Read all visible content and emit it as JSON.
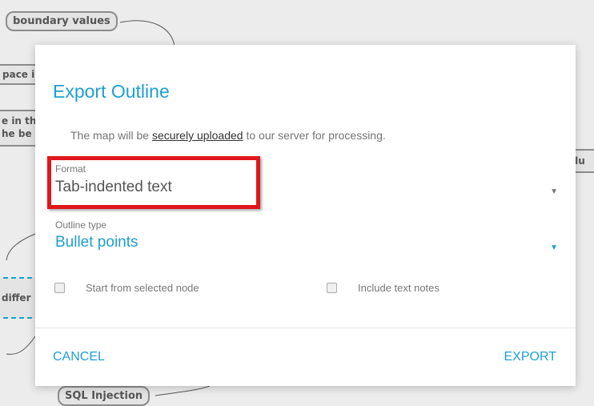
{
  "background_map": {
    "node_boundary": "boundary values",
    "node_sql": "SQL Injection",
    "frag_space": "pace i",
    "frag_in_the_line1": "e in th",
    "frag_in_the_line2": "he be",
    "frag_value": "alu",
    "frag_differ": "differ"
  },
  "dialog": {
    "title": "Export Outline",
    "description_prefix": "The map will be ",
    "description_link": "securely uploaded",
    "description_suffix": " to our server for processing.",
    "format": {
      "label": "Format",
      "value": "Tab-indented text",
      "arrow": "▼"
    },
    "outline_type": {
      "label": "Outline type",
      "value": "Bullet points",
      "arrow": "▼"
    },
    "checkbox_start_selected": {
      "label": "Start from selected node",
      "checked": false
    },
    "checkbox_include_notes": {
      "label": "Include text notes",
      "checked": false
    },
    "cancel_label": "CANCEL",
    "export_label": "EXPORT"
  },
  "colors": {
    "accent": "#1ea0cf",
    "highlight": "#e0171c",
    "background": "#ececec"
  }
}
